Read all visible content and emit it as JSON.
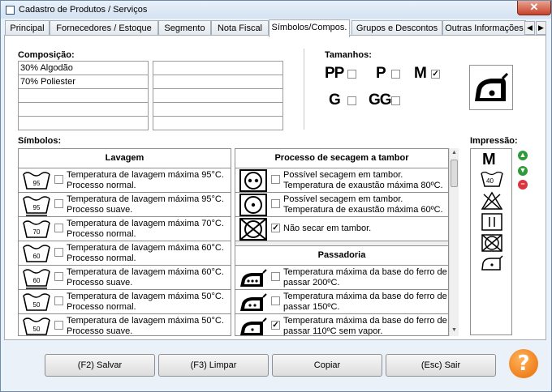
{
  "window": {
    "title": "Cadastro de Produtos / Serviços",
    "close_label": "✕"
  },
  "tabs": [
    {
      "label": "Principal"
    },
    {
      "label": "Fornecedores / Estoque"
    },
    {
      "label": "Segmento"
    },
    {
      "label": "Nota Fiscal"
    },
    {
      "label": "Símbolos/Compos."
    },
    {
      "label": "Grupos e Descontos"
    },
    {
      "label": "Outras Informações"
    }
  ],
  "tab_nav": {
    "left": "◀",
    "right": "▶"
  },
  "composicao": {
    "label": "Composição:",
    "left": [
      "30% Algodão",
      "70% Poliester",
      "",
      "",
      ""
    ],
    "right": [
      "",
      "",
      "",
      "",
      ""
    ]
  },
  "tamanhos": {
    "label": "Tamanhos:",
    "items": [
      {
        "label": "PP",
        "checked": false
      },
      {
        "label": "P",
        "checked": false
      },
      {
        "label": "M",
        "checked": true
      },
      {
        "label": "G",
        "checked": false
      },
      {
        "label": "GG",
        "checked": false
      }
    ]
  },
  "simbolos": {
    "label": "Símbolos:"
  },
  "lavagem": {
    "title": "Lavagem",
    "rows": [
      {
        "temp": "95",
        "text1": "Temperatura de lavagem máxima 95°C.",
        "text2": "Processo normal.",
        "checked": false
      },
      {
        "temp": "95",
        "text1": "Temperatura de lavagem máxima 95°C.",
        "text2": "Processo suave.",
        "checked": false
      },
      {
        "temp": "70",
        "text1": "Temperatura de lavagem máxima 70°C.",
        "text2": "Processo normal.",
        "checked": false
      },
      {
        "temp": "60",
        "text1": "Temperatura de lavagem máxima 60°C.",
        "text2": "Processo normal.",
        "checked": false
      },
      {
        "temp": "60",
        "text1": "Temperatura de lavagem máxima 60°C.",
        "text2": "Processo suave.",
        "checked": false
      },
      {
        "temp": "50",
        "text1": "Temperatura de lavagem máxima 50°C.",
        "text2": "Processo normal.",
        "checked": false
      },
      {
        "temp": "50",
        "text1": "Temperatura de lavagem máxima 50°C.",
        "text2": "Processo suave.",
        "checked": false
      }
    ]
  },
  "secagem": {
    "title": "Processo de secagem a tambor",
    "rows": [
      {
        "text1": "Possível secagem em tambor.",
        "text2": "Temperatura de exaustão máxima 80ºC.",
        "checked": false
      },
      {
        "text1": "Possível secagem em tambor.",
        "text2": "Temperatura de exaustão máxima 60ºC.",
        "checked": false
      },
      {
        "text1": "Não secar em tambor.",
        "text2": "",
        "checked": true
      }
    ]
  },
  "passadoria": {
    "title": "Passadoria",
    "rows": [
      {
        "text1": "Temperatura máxima da base do ferro de",
        "text2": "passar 200ºC.",
        "checked": false
      },
      {
        "text1": "Temperatura máxima da base do ferro de",
        "text2": "passar 150ºC.",
        "checked": false
      },
      {
        "text1": "Temperatura máxima da base do ferro de",
        "text2": "passar 110ºC sem vapor.",
        "checked": true
      }
    ]
  },
  "impressao": {
    "label": "Impressão:",
    "size": "M",
    "temp": "40"
  },
  "buttons": {
    "salvar": "(F2) Salvar",
    "limpar": "(F3) Limpar",
    "copiar": "Copiar",
    "sair": "(Esc) Sair",
    "help": "?"
  },
  "colors": {
    "accent_green": "#2e9a3a",
    "accent_red": "#d9363e",
    "help_orange": "#f07d10"
  }
}
